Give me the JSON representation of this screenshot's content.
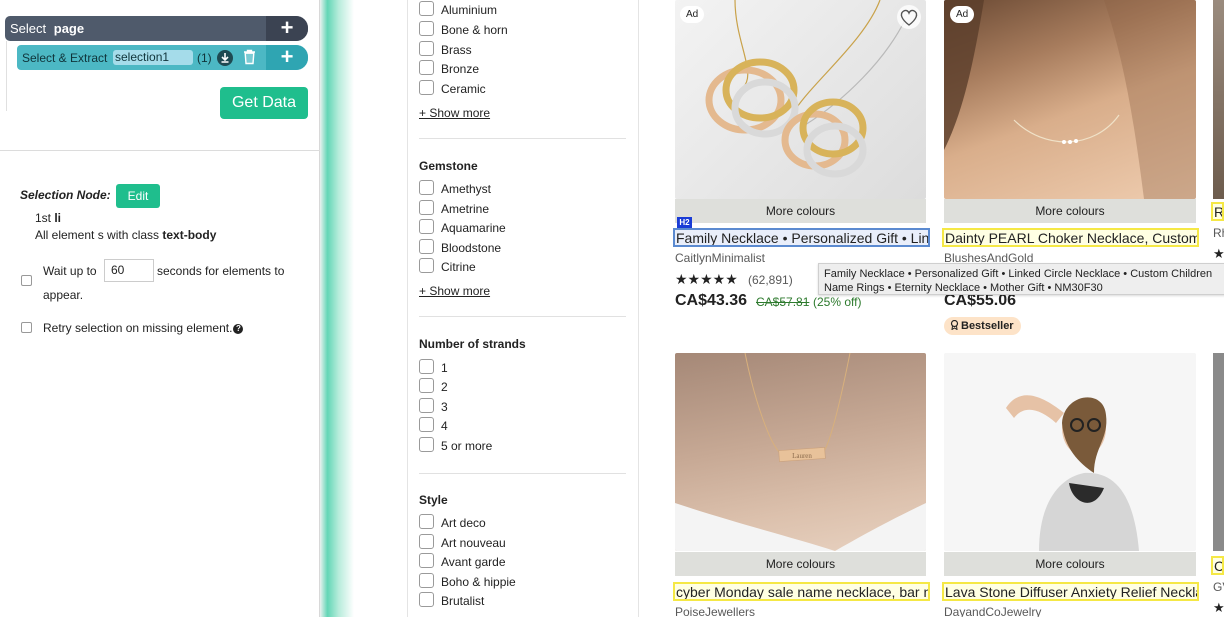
{
  "scraper": {
    "select_label": "Select",
    "page_label": "page",
    "plus_symbol": "+",
    "extract_label": "Select & Extract",
    "selection_name": "selection1",
    "selection_count": "(1)",
    "get_data_label": "Get Data",
    "node_label": "Selection Node:",
    "edit_label": "Edit",
    "node_first_prefix": "1st ",
    "node_first_tag": "li",
    "node_desc_prefix": "All element s with class ",
    "node_desc_class": "text-body",
    "wait_text_1": "Wait up to",
    "wait_value": "60",
    "wait_text_2": "seconds for elements to",
    "wait_text_3": "appear.",
    "retry_text": "Retry selection on missing element.",
    "help_symbol": "?",
    "icons": {
      "download": "download-icon",
      "trash": "trash-icon",
      "help": "help-icon"
    }
  },
  "filters": {
    "material_items": [
      "Aluminium",
      "Bone & horn",
      "Brass",
      "Bronze",
      "Ceramic"
    ],
    "material_more": "+ Show more",
    "gemstone_head": "Gemstone",
    "gemstone_items": [
      "Amethyst",
      "Ametrine",
      "Aquamarine",
      "Bloodstone",
      "Citrine"
    ],
    "gemstone_more": "+ Show more",
    "strands_head": "Number of strands",
    "strands_items": [
      "1",
      "2",
      "3",
      "4",
      "5 or more"
    ],
    "style_head": "Style",
    "style_items": [
      "Art deco",
      "Art nouveau",
      "Avant garde",
      "Boho & hippie",
      "Brutalist"
    ]
  },
  "products": {
    "ad_label": "Ad",
    "more_colours": "More colours",
    "h2_tag": "H2",
    "p1": {
      "title": "Family Necklace • Personalized Gift • Linked Circle Necklace",
      "shop": "CaitlynMinimalist",
      "stars": "★★★★★",
      "reviews": "(62,891)",
      "price": "CA$43.36",
      "old_price": "CA$57.81",
      "discount": "(25% off)"
    },
    "p2": {
      "title": "Dainty PEARL Choker Necklace, Custom Pearl Necklace",
      "shop": "BlushesAndGold",
      "price": "CA$55.06",
      "badge": "Bestseller"
    },
    "p3": {
      "title": "cyber Monday sale name necklace, bar necklace",
      "shop": "PoiseJewellers",
      "engraving": "Lauren"
    },
    "p4": {
      "title": "Lava Stone Diffuser Anxiety Relief Necklace",
      "shop": "DayandCoJewelry"
    },
    "col3": {
      "title_frag_1": "Ra",
      "shop_frag_1": "Rh",
      "title_frag_2": "C",
      "shop_frag_2": "GV",
      "star": "★"
    },
    "tooltip": {
      "line1": "Family Necklace • Personalized Gift • Linked Circle Necklace •  Custom Children",
      "line2": "Name Rings • Eternity Necklace • Mother Gift • NM30F30"
    }
  },
  "colors": {
    "accent_green": "#1fbe8d",
    "page_bar": "#4f5a6b",
    "extract_bar": "#4cb8c4",
    "highlight_yellow": "#f5e845",
    "highlight_blue": "#5b8ad0"
  }
}
